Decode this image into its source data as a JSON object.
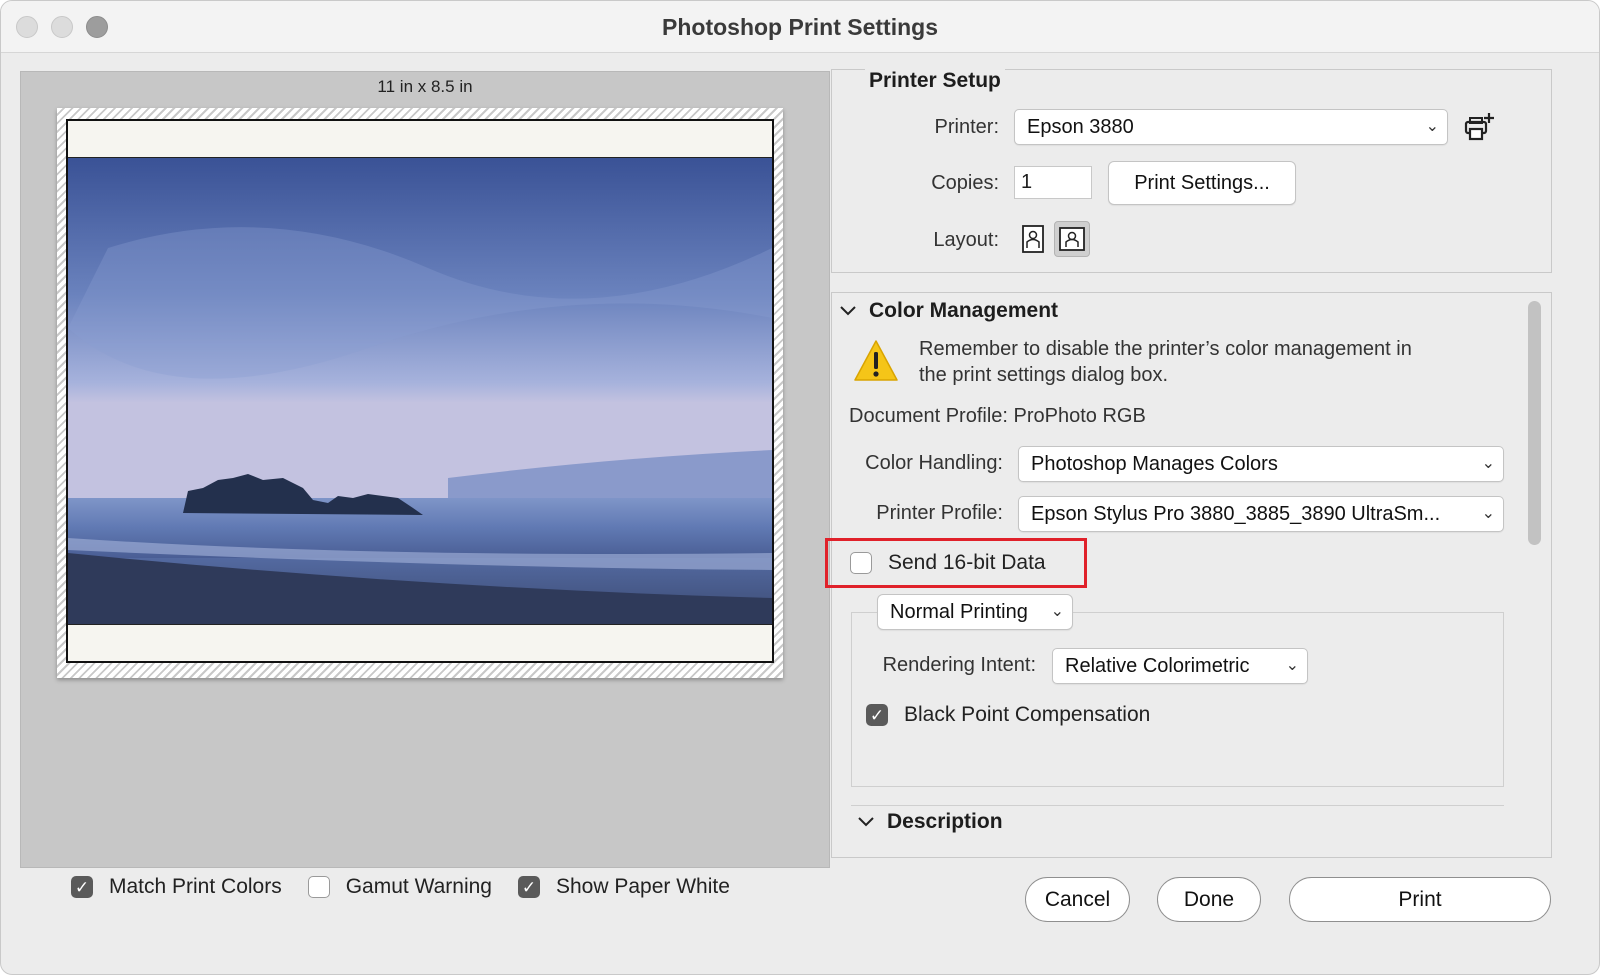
{
  "window": {
    "title": "Photoshop Print Settings"
  },
  "preview": {
    "paper_size": "11 in x 8.5 in",
    "options": [
      {
        "label": "Match Print Colors",
        "checked": true
      },
      {
        "label": "Gamut Warning",
        "checked": false
      },
      {
        "label": "Show Paper White",
        "checked": true
      }
    ]
  },
  "printer_setup": {
    "heading": "Printer Setup",
    "printer_label": "Printer:",
    "printer_value": "Epson 3880",
    "copies_label": "Copies:",
    "copies_value": "1",
    "print_settings_button": "Print Settings...",
    "layout_label": "Layout:",
    "layout_selected": "landscape"
  },
  "color_management": {
    "heading": "Color Management",
    "warning": "Remember to disable the printer’s color management in the print settings dialog box.",
    "document_profile": "Document Profile: ProPhoto RGB",
    "color_handling_label": "Color Handling:",
    "color_handling_value": "Photoshop Manages Colors",
    "printer_profile_label": "Printer Profile:",
    "printer_profile_value": "Epson Stylus Pro 3880_3885_3890 UltraSm...",
    "send_16bit_label": "Send 16-bit Data",
    "send_16bit_checked": false,
    "printing_mode_value": "Normal Printing",
    "rendering_intent_label": "Rendering Intent:",
    "rendering_intent_value": "Relative Colorimetric",
    "black_point_label": "Black Point Compensation",
    "black_point_checked": true,
    "highlight_color": "#e0212a"
  },
  "description": {
    "heading": "Description"
  },
  "footer": {
    "cancel": "Cancel",
    "done": "Done",
    "print": "Print"
  }
}
